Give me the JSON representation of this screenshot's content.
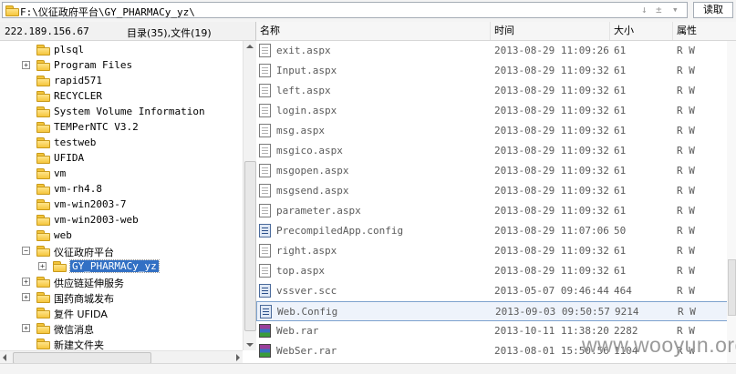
{
  "path_bar": {
    "path": "F:\\仪征政府平台\\GY_PHARMACy_yz\\",
    "controls": [
      "↓",
      "±",
      "▾"
    ],
    "read_button": "读取"
  },
  "left_panel": {
    "host": "222.189.156.67",
    "counts": "目录(35),文件(19)",
    "tree": [
      {
        "label": "plsql",
        "expander": ""
      },
      {
        "label": "Program Files",
        "expander": "+"
      },
      {
        "label": "rapid571",
        "expander": ""
      },
      {
        "label": "RECYCLER",
        "expander": ""
      },
      {
        "label": "System Volume Information",
        "expander": ""
      },
      {
        "label": "TEMPerNTC V3.2",
        "expander": ""
      },
      {
        "label": "testweb",
        "expander": ""
      },
      {
        "label": "UFIDA",
        "expander": ""
      },
      {
        "label": "vm",
        "expander": ""
      },
      {
        "label": "vm-rh4.8",
        "expander": ""
      },
      {
        "label": "vm-win2003-7",
        "expander": ""
      },
      {
        "label": "vm-win2003-web",
        "expander": ""
      },
      {
        "label": "web",
        "expander": ""
      },
      {
        "label": "仪征政府平台",
        "expander": "−"
      },
      {
        "label": "GY_PHARMACy_yz",
        "expander": "+"
      },
      {
        "label": "供应链延伸服务",
        "expander": "+"
      },
      {
        "label": "国药商城发布",
        "expander": "+"
      },
      {
        "label": "复件 UFIDA",
        "expander": ""
      },
      {
        "label": "微信消息",
        "expander": "+"
      },
      {
        "label": "新建文件夹",
        "expander": ""
      }
    ]
  },
  "columns": {
    "name": "名称",
    "time": "时间",
    "size": "大小",
    "attr": "属性"
  },
  "files": [
    {
      "name": "exit.aspx",
      "time": "2013-08-29 11:09:26",
      "size": "61",
      "attr": "R W",
      "icon": "file-icon"
    },
    {
      "name": "Input.aspx",
      "time": "2013-08-29 11:09:32",
      "size": "61",
      "attr": "R W",
      "icon": "file-icon"
    },
    {
      "name": "left.aspx",
      "time": "2013-08-29 11:09:32",
      "size": "61",
      "attr": "R W",
      "icon": "file-icon"
    },
    {
      "name": "login.aspx",
      "time": "2013-08-29 11:09:32",
      "size": "61",
      "attr": "R W",
      "icon": "file-icon"
    },
    {
      "name": "msg.aspx",
      "time": "2013-08-29 11:09:32",
      "size": "61",
      "attr": "R W",
      "icon": "file-icon"
    },
    {
      "name": "msgico.aspx",
      "time": "2013-08-29 11:09:32",
      "size": "61",
      "attr": "R W",
      "icon": "file-icon"
    },
    {
      "name": "msgopen.aspx",
      "time": "2013-08-29 11:09:32",
      "size": "61",
      "attr": "R W",
      "icon": "file-icon"
    },
    {
      "name": "msgsend.aspx",
      "time": "2013-08-29 11:09:32",
      "size": "61",
      "attr": "R W",
      "icon": "file-icon"
    },
    {
      "name": "parameter.aspx",
      "time": "2013-08-29 11:09:32",
      "size": "61",
      "attr": "R W",
      "icon": "file-icon"
    },
    {
      "name": "PrecompiledApp.config",
      "time": "2013-08-29 11:07:06",
      "size": "50",
      "attr": "R W",
      "icon": "config-icon"
    },
    {
      "name": "right.aspx",
      "time": "2013-08-29 11:09:32",
      "size": "61",
      "attr": "R W",
      "icon": "file-icon"
    },
    {
      "name": "top.aspx",
      "time": "2013-08-29 11:09:32",
      "size": "61",
      "attr": "R W",
      "icon": "file-icon"
    },
    {
      "name": "vssver.scc",
      "time": "2013-05-07 09:46:44",
      "size": "464",
      "attr": "R W",
      "icon": "config-icon"
    },
    {
      "name": "Web.Config",
      "time": "2013-09-03 09:50:57",
      "size": "9214",
      "attr": "R W",
      "icon": "config-icon",
      "selected": true
    },
    {
      "name": "Web.rar",
      "time": "2013-10-11 11:38:20",
      "size": "2282",
      "attr": "R W",
      "icon": "rar-icon"
    },
    {
      "name": "WebSer.rar",
      "time": "2013-08-01 15:50:56",
      "size": "1104",
      "attr": "R W",
      "icon": "rar-icon"
    }
  ],
  "watermark": "www.wooyun.org",
  "colors": {
    "selection_bg": "#3270c4",
    "folder": "#f5c63c",
    "row_highlight": "#eef3fb"
  }
}
